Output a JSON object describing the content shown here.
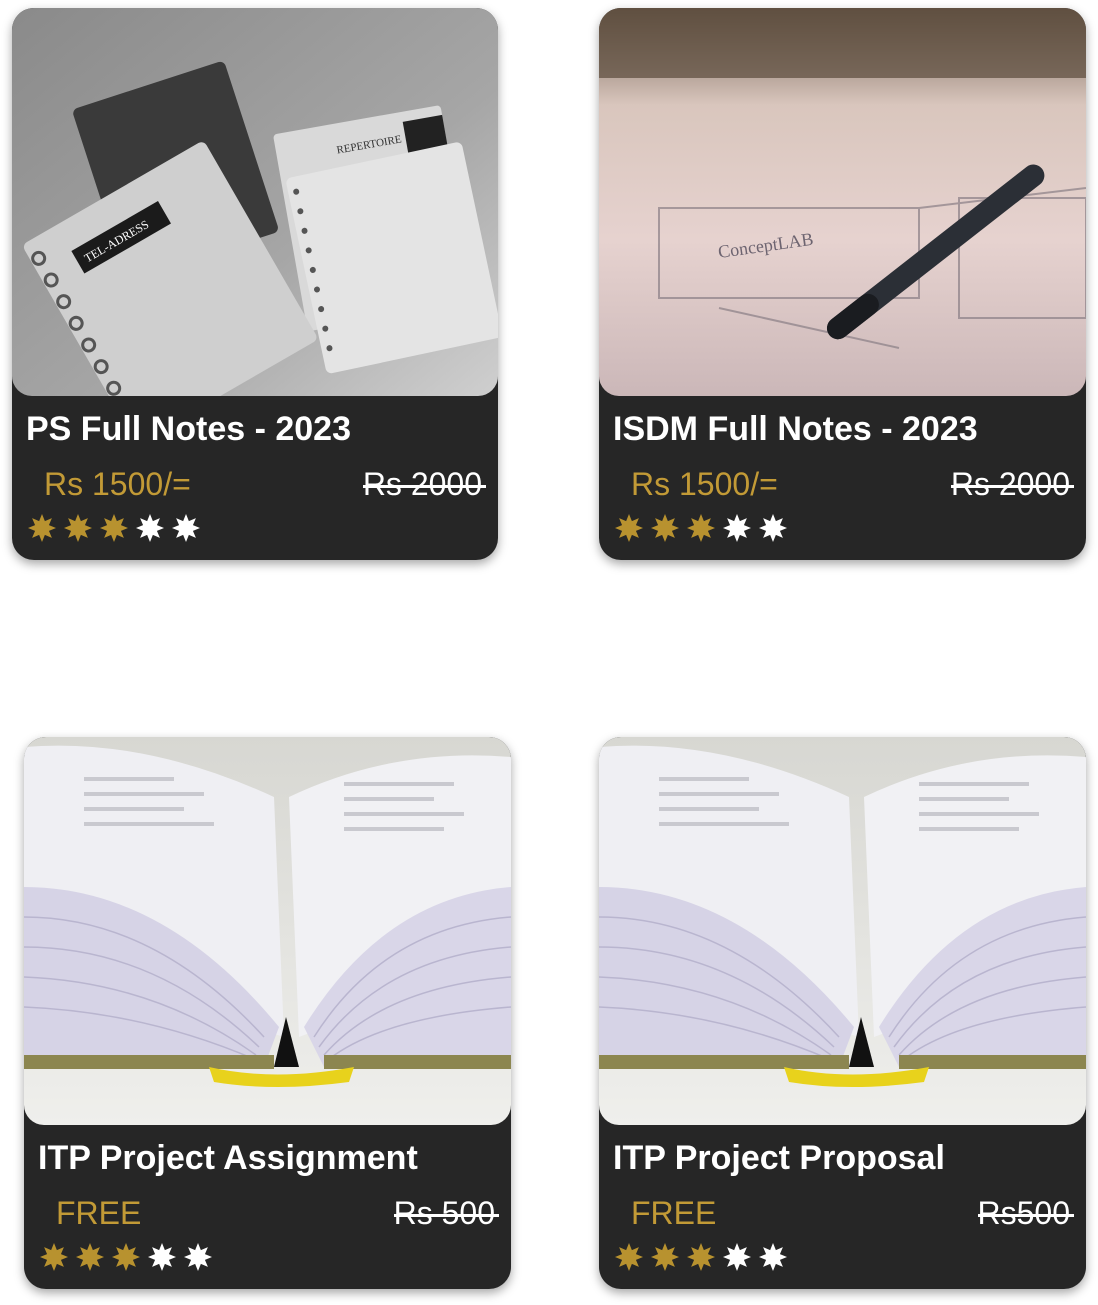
{
  "cards": [
    {
      "title": "PS Full Notes - 2023",
      "price": "Rs 1500/=",
      "old_price": "Rs 2000",
      "rating": 3,
      "max_rating": 5,
      "image": "spiral-notebooks-photo"
    },
    {
      "title": "ISDM Full Notes - 2023",
      "price": "Rs 1500/=",
      "old_price": "Rs 2000",
      "rating": 3,
      "max_rating": 5,
      "image": "pen-on-sketch-paper-photo"
    },
    {
      "title": "ITP Project Assignment",
      "price": "FREE",
      "old_price": "Rs 500",
      "rating": 3,
      "max_rating": 5,
      "image": "open-book-photo"
    },
    {
      "title": "ITP Project Proposal",
      "price": "FREE",
      "old_price": "Rs500",
      "rating": 3,
      "max_rating": 5,
      "image": "open-book-photo"
    }
  ],
  "colors": {
    "card_bg": "#262626",
    "price": "#c29a36",
    "star_filled": "#b8922f",
    "star_empty": "#ffffff"
  }
}
